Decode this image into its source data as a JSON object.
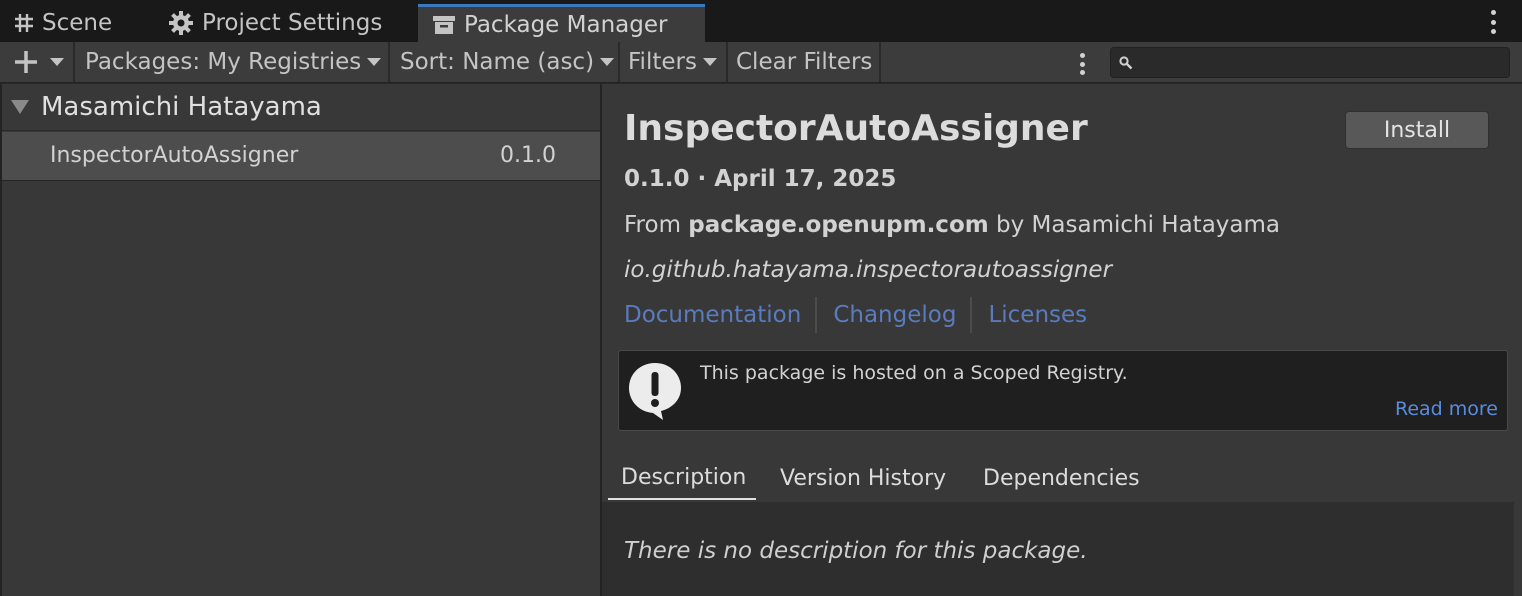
{
  "tabs": [
    {
      "label": "Scene",
      "icon": "grid-icon"
    },
    {
      "label": "Project Settings",
      "icon": "gear-icon"
    },
    {
      "label": "Package Manager",
      "icon": "package-icon",
      "active": true
    }
  ],
  "toolbar": {
    "add_icon": "plus-icon",
    "packages_label": "Packages: My Registries",
    "sort_label": "Sort: Name (asc)",
    "filters_label": "Filters",
    "clear_filters_label": "Clear Filters",
    "search_placeholder": ""
  },
  "package_list": {
    "group": "Masamichi Hatayama",
    "items": [
      {
        "name": "InspectorAutoAssigner",
        "version": "0.1.0",
        "selected": true
      }
    ]
  },
  "details": {
    "title": "InspectorAutoAssigner",
    "install_label": "Install",
    "version_date": "0.1.0 · April 17, 2025",
    "from_prefix": "From ",
    "registry": "package.openupm.com",
    "by_text": " by Masamichi Hatayama",
    "package_id": "io.github.hatayama.inspectorautoassigner",
    "links": [
      "Documentation",
      "Changelog",
      "Licenses"
    ],
    "notice": {
      "message": "This package is hosted on a Scoped Registry.",
      "read_more": "Read more"
    },
    "tabs": [
      "Description",
      "Version History",
      "Dependencies"
    ],
    "active_tab": "Description",
    "description": "There is no description for this package."
  },
  "colors": {
    "accent": "#3a79bb",
    "link": "#5a7bbd",
    "read_more": "#5a8ce0"
  }
}
